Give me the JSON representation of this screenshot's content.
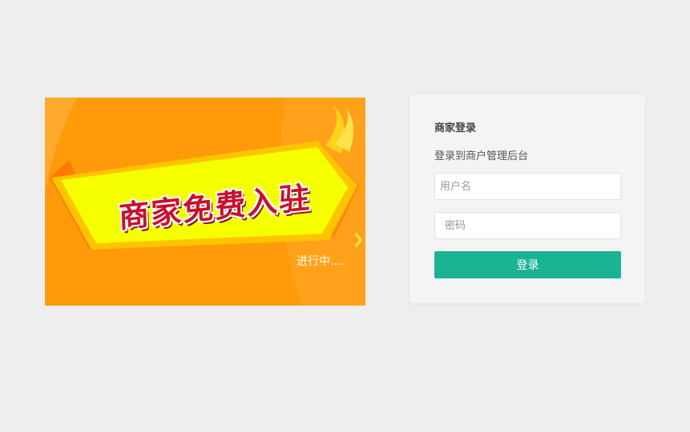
{
  "banner": {
    "title": "商家免费入驻",
    "subtitle": "进行中....",
    "colors": {
      "background": "#ff9a0a",
      "ribbon": "#f5ff00",
      "text": "#c8102e"
    }
  },
  "login": {
    "title": "商家登录",
    "subtitle": "登录到商户管理后台",
    "username_placeholder": "用户名",
    "password_placeholder": "密码",
    "submit_label": "登录",
    "accent_color": "#1ab394"
  }
}
